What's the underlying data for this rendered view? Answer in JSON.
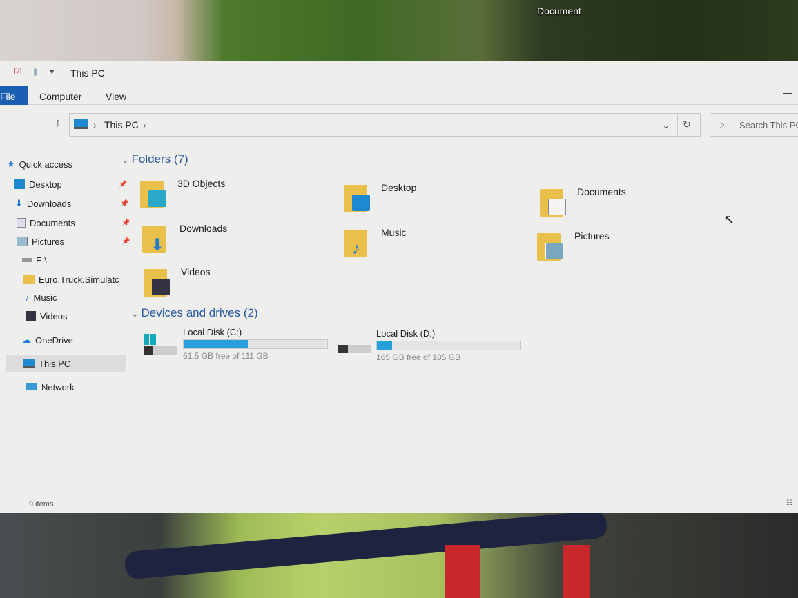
{
  "desktop": {
    "icon_label": "Document"
  },
  "window": {
    "title": "This PC",
    "ribbon_tabs": [
      "File",
      "Computer",
      "View"
    ],
    "address": {
      "path": [
        "This PC"
      ]
    },
    "search_placeholder": "Search This PC",
    "sidebar": [
      {
        "label": "Quick access",
        "icon": "star-icon"
      },
      {
        "label": "Desktop",
        "icon": "desktop-icon",
        "pinned": true
      },
      {
        "label": "Downloads",
        "icon": "download-icon",
        "pinned": true
      },
      {
        "label": "Documents",
        "icon": "document-icon",
        "pinned": true
      },
      {
        "label": "Pictures",
        "icon": "picture-icon",
        "pinned": true
      },
      {
        "label": "E:\\",
        "icon": "drive-icon"
      },
      {
        "label": "Euro.Truck.Simulatc",
        "icon": "folder-icon"
      },
      {
        "label": "Music",
        "icon": "music-icon"
      },
      {
        "label": "Videos",
        "icon": "video-icon"
      },
      {
        "label": "OneDrive",
        "icon": "cloud-icon"
      },
      {
        "label": "This PC",
        "icon": "computer-icon",
        "selected": true
      },
      {
        "label": "Network",
        "icon": "network-icon"
      }
    ],
    "folders_header": "Folders (7)",
    "folders": [
      "3D Objects",
      "Desktop",
      "Documents",
      "Downloads",
      "Music",
      "Pictures",
      "Videos"
    ],
    "drives_header": "Devices and drives (2)",
    "drives": [
      {
        "name": "Local Disk (C:)",
        "free_text": "61.5 GB free of 111 GB",
        "used_percent": 44.6
      },
      {
        "name": "Local Disk (D:)",
        "free_text": "165 GB free of 185 GB",
        "used_percent": 10.8
      }
    ],
    "status": "9 items",
    "accent": "#26a0da"
  }
}
